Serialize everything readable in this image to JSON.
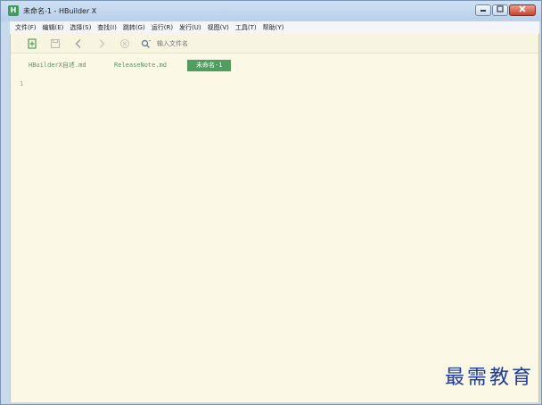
{
  "window": {
    "title": "未命名-1 - HBuilder X",
    "app_icon_letter": "H"
  },
  "menu": [
    "文件(F)",
    "编辑(E)",
    "选择(S)",
    "查找(I)",
    "跳转(G)",
    "运行(R)",
    "发行(U)",
    "视图(V)",
    "工具(T)",
    "帮助(Y)"
  ],
  "toolbar": {
    "search_placeholder": "输入文件名"
  },
  "tabs": [
    {
      "label": "HBuilderX自述.md",
      "active": false
    },
    {
      "label": "ReleaseNote.md",
      "active": false
    },
    {
      "label": "未命名-1",
      "active": true
    }
  ],
  "editor": {
    "line_number": "1"
  },
  "watermark": "最需教育",
  "colors": {
    "editor_bg": "#fbf9e6",
    "active_tab": "#4f9d5f",
    "watermark": "#1d3a9a"
  }
}
